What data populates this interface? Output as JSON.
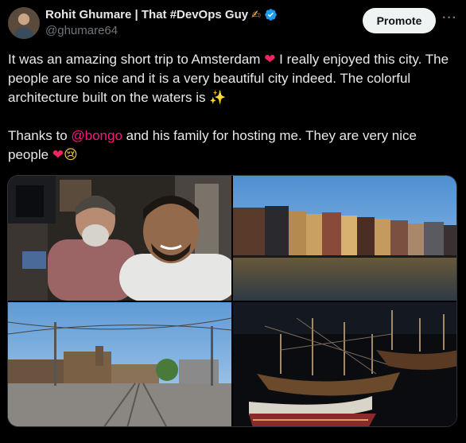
{
  "tweet": {
    "author": {
      "display_name": "Rohit Ghumare | That #DevOps Guy",
      "name_emoji": "✍",
      "handle": "@ghumare64"
    },
    "promote_label": "Promote",
    "more_label": "···",
    "text": {
      "line1_a": "It was an amazing short trip to Amsterdam ",
      "heart1": "❤",
      "line1_b": " I really enjoyed this city. The people are so nice and it is a very beautiful city indeed. The colorful architecture built on the waters is ",
      "sparkles": "✨",
      "para2_a": "Thanks to ",
      "mention": "@bongo",
      "para2_b": " and his family for hosting me. They are very nice people ",
      "heart2": "❤",
      "tear_face": "😢"
    },
    "media": {
      "count": 4,
      "items": [
        "selfie",
        "canal-houses",
        "tram-street",
        "ship-models"
      ]
    }
  },
  "colors": {
    "background": "#000000",
    "text": "#e7e9ea",
    "secondary": "#71767b",
    "mention": "#f91880",
    "verified": "#1d9bf0",
    "promote_bg": "#eff3f4"
  }
}
